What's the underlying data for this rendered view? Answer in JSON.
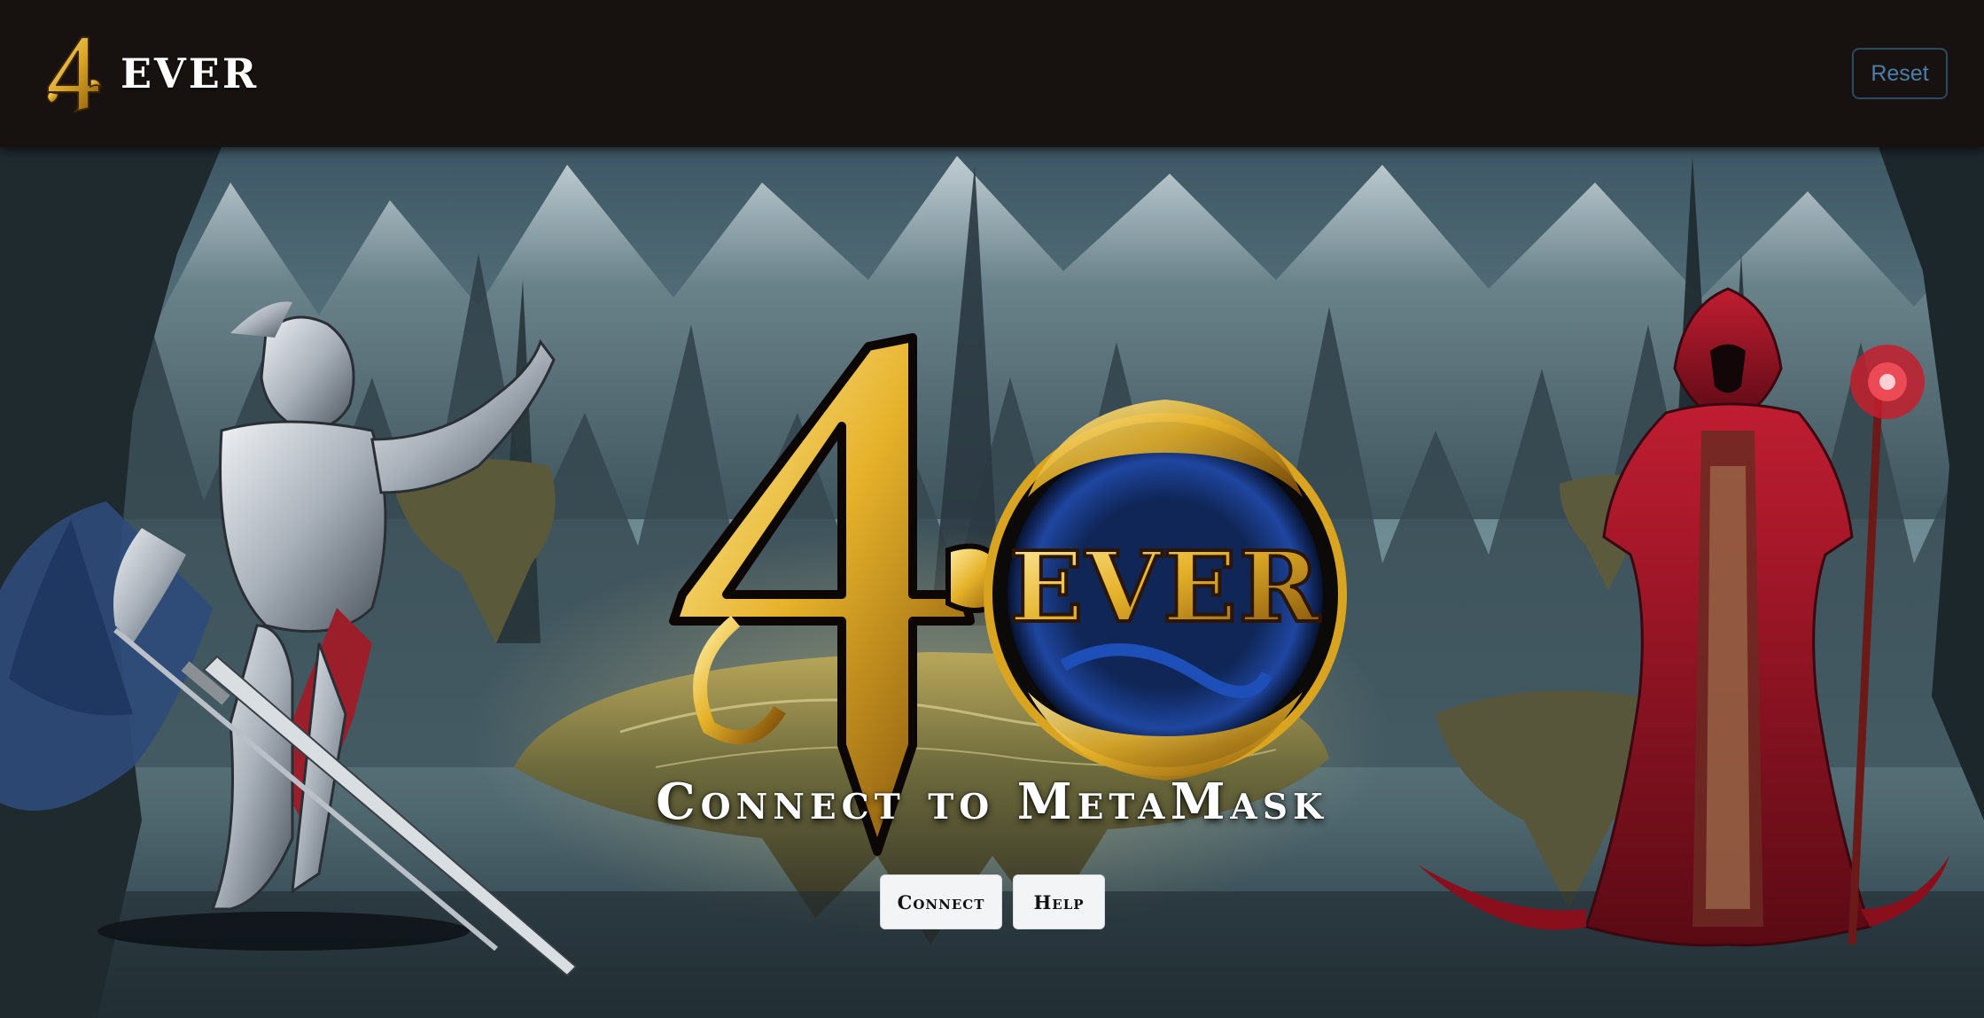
{
  "header": {
    "brand_text": "EVER",
    "logo_icon": "4ever-logo-icon",
    "reset_label": "Reset"
  },
  "hero": {
    "title": "Connect to MetaMask",
    "connect_label": "Connect",
    "help_label": "Help",
    "emblem_icon": "4ever-emblem-icon",
    "left_figure": "armored-knight-icon",
    "right_figure": "hooded-mage-icon"
  },
  "colors": {
    "header_bg": "#17120f",
    "reset_border": "#2b4a63",
    "reset_text": "#4d7ea8",
    "gold": "#d9a420",
    "button_bg": "#f3f4f6",
    "mage_red": "#a3162a",
    "knight_silver": "#c7cdd4"
  }
}
